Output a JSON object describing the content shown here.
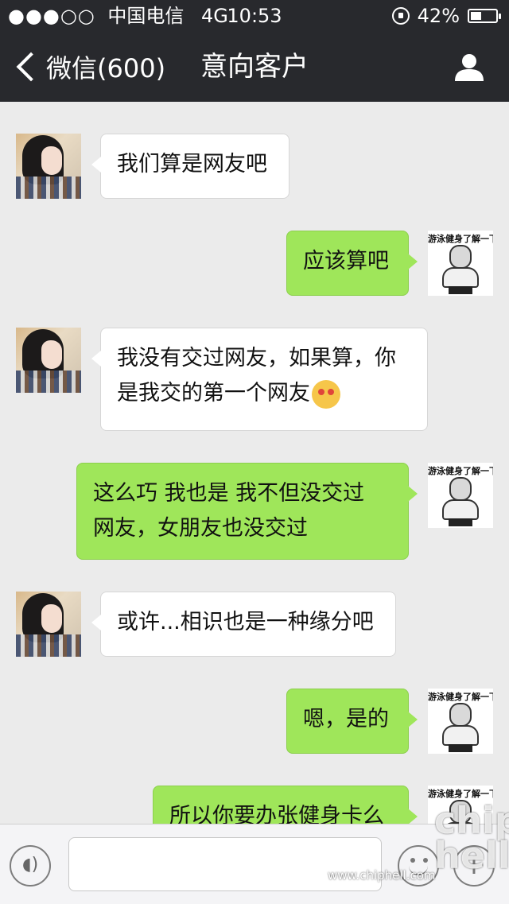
{
  "status_bar": {
    "signal": "●●●○○",
    "carrier": "中国电信",
    "network": "4G",
    "time": "10:53",
    "battery_percent": "42%",
    "battery_level": 0.42
  },
  "nav": {
    "back_label": "微信(600)",
    "title": "意向客户"
  },
  "meme_caption": "游泳健身了解一下",
  "messages": [
    {
      "side": "in",
      "text": "我们算是网友吧"
    },
    {
      "side": "out",
      "text": "应该算吧"
    },
    {
      "side": "in",
      "line1": "我没有交过网友，如果算，你",
      "line2": "是我交的第一个网友"
    },
    {
      "side": "out",
      "line1": "这么巧 我也是 我不但没交过",
      "line2": "网友，女朋友也没交过"
    },
    {
      "side": "in",
      "text": "或许...相识也是一种缘分吧"
    },
    {
      "side": "out",
      "text": "嗯，是的"
    },
    {
      "side": "out",
      "text": "所以你要办张健身卡么"
    }
  ],
  "input": {
    "placeholder": ""
  },
  "watermark": {
    "logo": "chip hell",
    "url": "www.chiphell.com"
  },
  "colors": {
    "bar": "#28292d",
    "bubble_out": "#9fe65a",
    "bubble_in": "#ffffff",
    "background": "#ebebeb"
  }
}
